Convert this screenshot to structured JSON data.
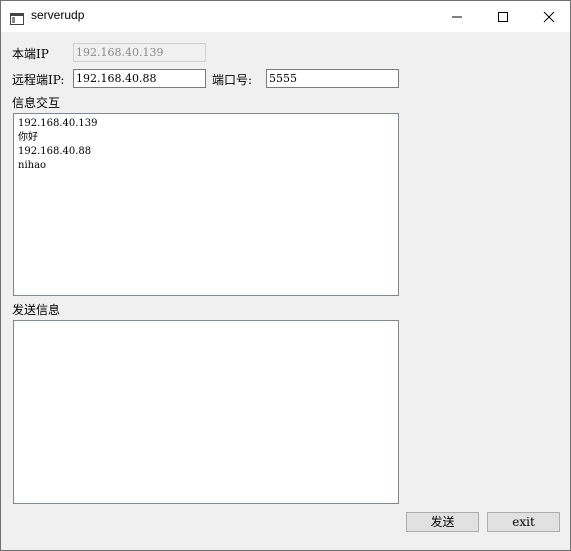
{
  "window": {
    "title": "serverudp"
  },
  "local": {
    "label": "本端IP",
    "ip_value": "192.168.40.139"
  },
  "remote": {
    "label": "远程端IP:",
    "ip_value": "192.168.40.88",
    "port_label": "端口号:",
    "port_value": "5555"
  },
  "exchange": {
    "label": "信息交互",
    "lines": [
      "192.168.40.139",
      "你好",
      "192.168.40.88",
      "nihao"
    ]
  },
  "send_info": {
    "label": "发送信息",
    "value": ""
  },
  "buttons": {
    "send_label": "发送",
    "exit_label": "exit"
  },
  "icons": {
    "app": "window-icon",
    "minimize": "minimize-icon",
    "maximize": "maximize-icon",
    "close": "close-icon"
  }
}
